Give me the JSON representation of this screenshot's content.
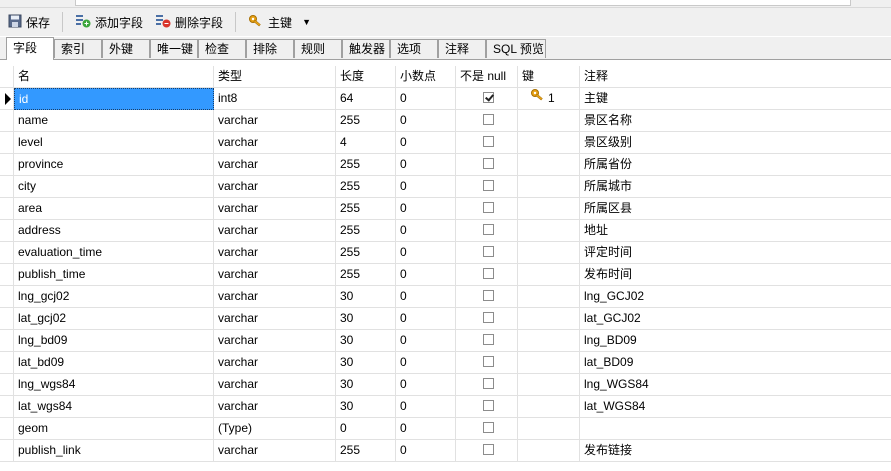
{
  "toolbar": {
    "save_label": "保存",
    "add_field_label": "添加字段",
    "delete_field_label": "删除字段",
    "primary_key_label": "主键"
  },
  "tabs": [
    "字段",
    "索引",
    "外键",
    "唯一键",
    "检查",
    "排除",
    "规则",
    "触发器",
    "选项",
    "注释",
    "SQL 预览"
  ],
  "active_tab": "字段",
  "columns": [
    "名",
    "类型",
    "长度",
    "小数点",
    "不是 null",
    "键",
    "注释"
  ],
  "rows": [
    {
      "name": "id",
      "type": "int8",
      "length": "64",
      "decimals": "0",
      "not_null": true,
      "key": "1",
      "comment": "主键"
    },
    {
      "name": "name",
      "type": "varchar",
      "length": "255",
      "decimals": "0",
      "not_null": false,
      "key": "",
      "comment": "景区名称"
    },
    {
      "name": "level",
      "type": "varchar",
      "length": "4",
      "decimals": "0",
      "not_null": false,
      "key": "",
      "comment": "景区级别"
    },
    {
      "name": "province",
      "type": "varchar",
      "length": "255",
      "decimals": "0",
      "not_null": false,
      "key": "",
      "comment": "所属省份"
    },
    {
      "name": "city",
      "type": "varchar",
      "length": "255",
      "decimals": "0",
      "not_null": false,
      "key": "",
      "comment": "所属城市"
    },
    {
      "name": "area",
      "type": "varchar",
      "length": "255",
      "decimals": "0",
      "not_null": false,
      "key": "",
      "comment": "所属区县"
    },
    {
      "name": "address",
      "type": "varchar",
      "length": "255",
      "decimals": "0",
      "not_null": false,
      "key": "",
      "comment": "地址"
    },
    {
      "name": "evaluation_time",
      "type": "varchar",
      "length": "255",
      "decimals": "0",
      "not_null": false,
      "key": "",
      "comment": "评定时间"
    },
    {
      "name": "publish_time",
      "type": "varchar",
      "length": "255",
      "decimals": "0",
      "not_null": false,
      "key": "",
      "comment": "发布时间"
    },
    {
      "name": "lng_gcj02",
      "type": "varchar",
      "length": "30",
      "decimals": "0",
      "not_null": false,
      "key": "",
      "comment": "lng_GCJ02"
    },
    {
      "name": "lat_gcj02",
      "type": "varchar",
      "length": "30",
      "decimals": "0",
      "not_null": false,
      "key": "",
      "comment": "lat_GCJ02"
    },
    {
      "name": "lng_bd09",
      "type": "varchar",
      "length": "30",
      "decimals": "0",
      "not_null": false,
      "key": "",
      "comment": "lng_BD09"
    },
    {
      "name": "lat_bd09",
      "type": "varchar",
      "length": "30",
      "decimals": "0",
      "not_null": false,
      "key": "",
      "comment": "lat_BD09"
    },
    {
      "name": "lng_wgs84",
      "type": "varchar",
      "length": "30",
      "decimals": "0",
      "not_null": false,
      "key": "",
      "comment": "lng_WGS84"
    },
    {
      "name": "lat_wgs84",
      "type": "varchar",
      "length": "30",
      "decimals": "0",
      "not_null": false,
      "key": "",
      "comment": "lat_WGS84"
    },
    {
      "name": "geom",
      "type": "(Type)",
      "length": "0",
      "decimals": "0",
      "not_null": false,
      "key": "",
      "comment": ""
    },
    {
      "name": "publish_link",
      "type": "varchar",
      "length": "255",
      "decimals": "0",
      "not_null": false,
      "key": "",
      "comment": "发布链接"
    }
  ],
  "selected_row": 0,
  "icons": {
    "save": "save-icon",
    "add_field": "add-field-icon",
    "delete_field": "delete-field-icon",
    "primary_key": "key-icon"
  },
  "colors": {
    "selection": "#3399ff",
    "key": "#e8a317"
  }
}
